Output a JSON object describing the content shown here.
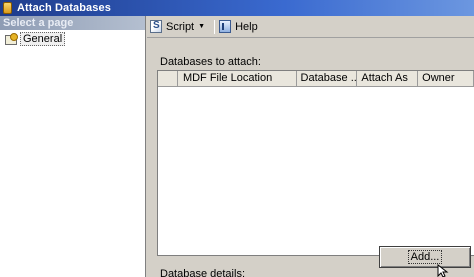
{
  "window": {
    "title": "Attach Databases"
  },
  "left_pane": {
    "header": "Select a page",
    "items": [
      {
        "label": "General",
        "icon": "page-icon"
      }
    ]
  },
  "toolbar": {
    "script_label": "Script",
    "help_label": "Help"
  },
  "databases_section": {
    "label": "Databases to attach:",
    "columns": [
      "MDF File Location",
      "Database ...",
      "Attach As",
      "Owner"
    ],
    "rows": []
  },
  "add_button": {
    "label": "Add..."
  },
  "details_section": {
    "label": "Database details:"
  }
}
